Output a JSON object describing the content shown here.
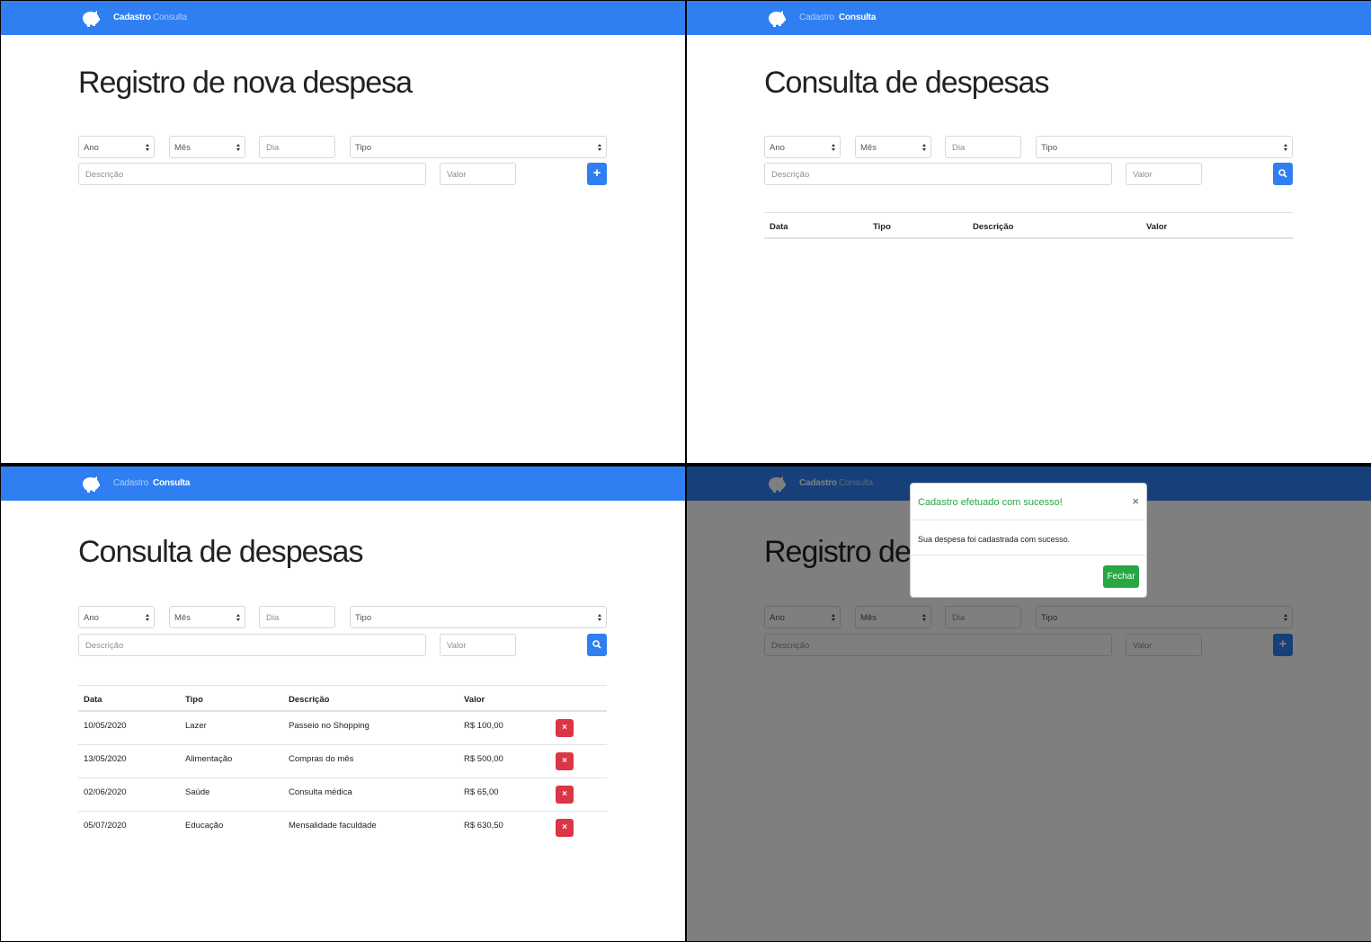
{
  "nav": {
    "cadastro": "Cadastro",
    "consulta": "Consulta"
  },
  "colors": {
    "navbar": "#2f7ff2",
    "danger": "#dc3545",
    "success": "#28a745"
  },
  "icons": {
    "logo": "piggy-bank-icon",
    "add": "plus-icon",
    "search": "search-icon",
    "delete": "close-icon"
  },
  "titles": {
    "registro": "Registro de nova despesa",
    "consulta": "Consulta de despesas",
    "registro_partial": "Registro de n"
  },
  "form": {
    "ano": "Ano",
    "mes": "Mês",
    "dia": "Dia",
    "tipo": "Tipo",
    "descricao": "Descrição",
    "valor": "Valor"
  },
  "table": {
    "headers": [
      "Data",
      "Tipo",
      "Descrição",
      "Valor"
    ],
    "rows": [
      [
        "10/05/2020",
        "Lazer",
        "Passeio no Shopping",
        "R$ 100,00"
      ],
      [
        "13/05/2020",
        "Alimentação",
        "Compras do mês",
        "R$ 500,00"
      ],
      [
        "02/06/2020",
        "Saúde",
        "Consulta médica",
        "R$ 65,00"
      ],
      [
        "05/07/2020",
        "Educação",
        "Mensalidade faculdade",
        "R$ 630,50"
      ]
    ]
  },
  "modal": {
    "title": "Cadastro efetuado com sucesso!",
    "close": "×",
    "body": "Sua despesa foi cadastrada com sucesso.",
    "button": "Fechar"
  }
}
